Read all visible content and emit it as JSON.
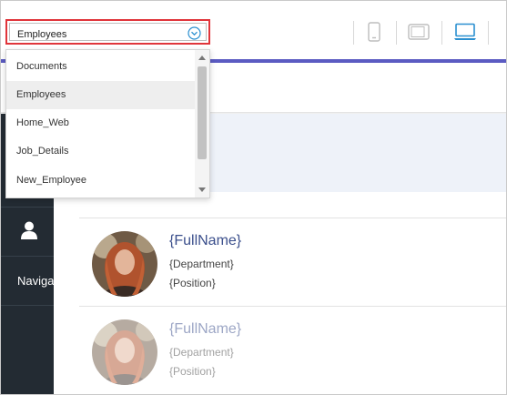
{
  "select": {
    "value": "Employees"
  },
  "dropdown": {
    "options": [
      {
        "label": "Documents"
      },
      {
        "label": "Employees"
      },
      {
        "label": "Home_Web"
      },
      {
        "label": "Job_Details"
      },
      {
        "label": "New_Employee"
      }
    ],
    "selected_index": 1
  },
  "toolbar": {
    "devices": [
      {
        "icon": "phone-icon"
      },
      {
        "icon": "tablet-icon"
      },
      {
        "icon": "laptop-icon"
      }
    ],
    "active_device": "laptop",
    "accent_color": "#2a8fd0"
  },
  "sidebar": {
    "nav_label": "Naviga"
  },
  "employees": [
    {
      "fullname": "{FullName}",
      "department": "{Department}",
      "position": "{Position}"
    },
    {
      "fullname": "{FullName}",
      "department": "{Department}",
      "position": "{Position}"
    }
  ],
  "colors": {
    "highlight_border": "#e0343a",
    "preview_accent": "#5b5bc2",
    "sidebar_bg": "#232b33",
    "name_color": "#3b4f8c"
  }
}
